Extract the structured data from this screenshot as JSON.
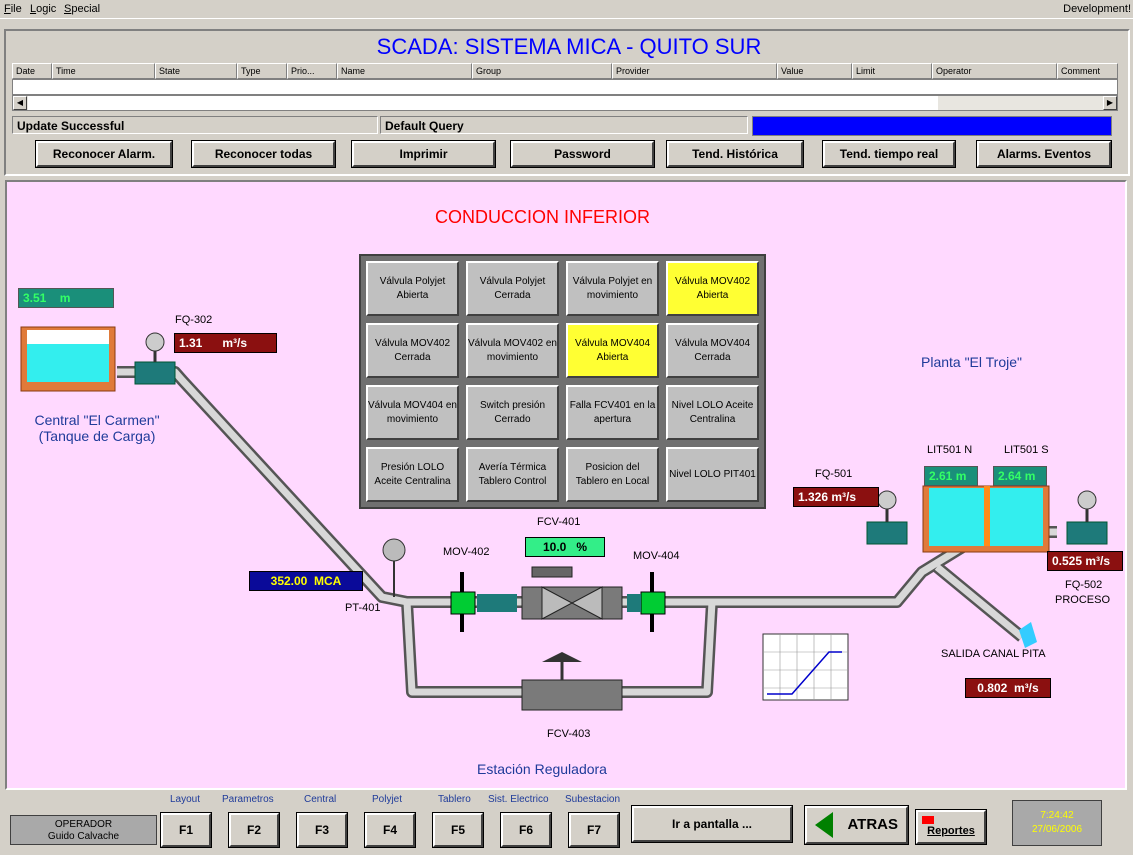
{
  "menu": {
    "items": [
      "File",
      "Logic",
      "Special"
    ],
    "right_label": "Development!"
  },
  "alarm": {
    "title": "SCADA: SISTEMA MICA - QUITO SUR",
    "columns": [
      "Date",
      "Time",
      "State",
      "Type",
      "Prio...",
      "Name",
      "Group",
      "Provider",
      "Value",
      "Limit",
      "Operator",
      "Comment"
    ],
    "status": "Update Successful",
    "query": "Default Query"
  },
  "toolbar": {
    "buttons": [
      "Reconocer Alarm.",
      "Reconocer todas",
      "Imprimir",
      "Password",
      "Tend. Histórica",
      "Tend. tiempo real",
      "Alarms. Eventos"
    ]
  },
  "process": {
    "title": "CONDUCCION INFERIOR",
    "tank_level": {
      "value": "3.51",
      "unit": "m"
    },
    "fq302": {
      "tag": "FQ-302",
      "value": "1.31",
      "unit": "m³/s"
    },
    "central": {
      "line1": "Central \"El Carmen\"",
      "line2": "(Tanque de Carga)"
    },
    "pt401": {
      "tag": "PT-401",
      "value": "352.00",
      "unit": "MCA"
    },
    "fcv401": {
      "tag": "FCV-401",
      "value": "10.0",
      "unit": "%"
    },
    "mov402": "MOV-402",
    "mov404": "MOV-404",
    "fcv403": "FCV-403",
    "estacion": "Estación Reguladora",
    "planta": "Planta \"El Troje\"",
    "lit501n": {
      "tag": "LIT501 N",
      "value": "2.61 m"
    },
    "lit501s": {
      "tag": "LIT501 S",
      "value": "2.64 m"
    },
    "fq501": {
      "tag": "FQ-501",
      "value": "1.326",
      "unit": "m³/s"
    },
    "fq502": {
      "value": "0.525",
      "unit": "m³/s",
      "tag": "FQ-502",
      "sub": "PROCESO"
    },
    "salida": {
      "label": "SALIDA CANAL PITA",
      "value": "0.802",
      "unit": "m³/s"
    },
    "indicators": [
      {
        "text": "Válvula Polyjet Abierta",
        "active": false
      },
      {
        "text": "Válvula Polyjet Cerrada",
        "active": false
      },
      {
        "text": "Válvula Polyjet en movimiento",
        "active": false
      },
      {
        "text": "Válvula MOV402 Abierta",
        "active": true
      },
      {
        "text": "Válvula MOV402 Cerrada",
        "active": false
      },
      {
        "text": "Válvula MOV402 en movimiento",
        "active": false
      },
      {
        "text": "Válvula MOV404 Abierta",
        "active": true
      },
      {
        "text": "Válvula MOV404 Cerrada",
        "active": false
      },
      {
        "text": "Válvula MOV404 en movimiento",
        "active": false
      },
      {
        "text": "Switch presión Cerrado",
        "active": false
      },
      {
        "text": "Falla FCV401 en la apertura",
        "active": false
      },
      {
        "text": "Nivel LOLO Aceite Centralina",
        "active": false
      },
      {
        "text": "Presión LOLO Aceite Centralina",
        "active": false
      },
      {
        "text": "Avería Térmica Tablero Control",
        "active": false
      },
      {
        "text": "Posicion del Tablero en Local",
        "active": false
      },
      {
        "text": "Nivel LOLO PIT401",
        "active": false
      }
    ]
  },
  "bottom": {
    "operator": {
      "role": "OPERADOR",
      "name": "Guido Calvache"
    },
    "fkeys": [
      {
        "caption": "Layout",
        "key": "F1"
      },
      {
        "caption": "Parametros",
        "key": "F2"
      },
      {
        "caption": "Central",
        "key": "F3"
      },
      {
        "caption": "Polyjet",
        "key": "F4"
      },
      {
        "caption": "Tablero",
        "key": "F5"
      },
      {
        "caption": "Sist. Electrico",
        "key": "F6"
      },
      {
        "caption": "Subestacion",
        "key": "F7"
      }
    ],
    "ir_pantalla": "Ir a pantalla ...",
    "atras": "ATRAS",
    "reportes": "Reportes",
    "time": "7:24:42",
    "date": "27/06/2006"
  },
  "colors": {
    "background": "#ffd9ff",
    "title_red": "#ff0000",
    "scada_blue": "#0000ff",
    "active_yellow": "#ffff33"
  }
}
